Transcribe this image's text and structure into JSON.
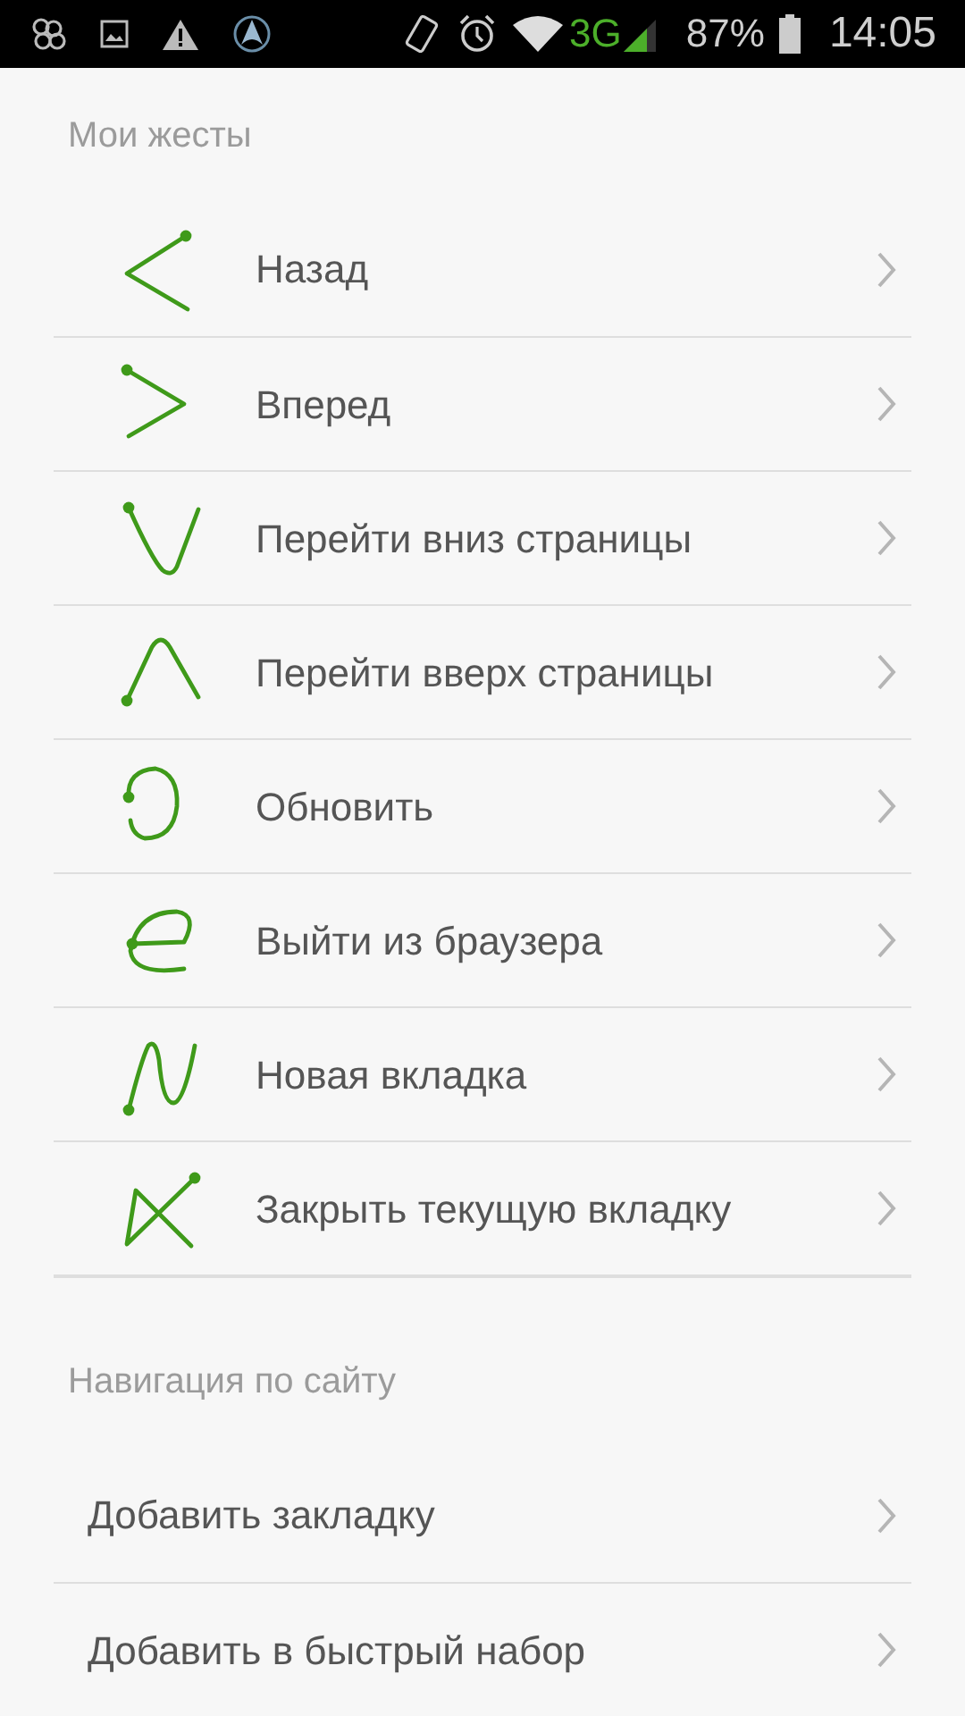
{
  "status_bar": {
    "network": "3G",
    "battery": "87%",
    "time": "14:05"
  },
  "sections": [
    {
      "title": "Мои жесты",
      "items": [
        {
          "label": "Назад",
          "kind": "back"
        },
        {
          "label": "Вперед",
          "kind": "forward"
        },
        {
          "label": "Перейти вниз страницы",
          "kind": "down"
        },
        {
          "label": "Перейти вверх страницы",
          "kind": "up"
        },
        {
          "label": "Обновить",
          "kind": "refresh"
        },
        {
          "label": "Выйти из браузера",
          "kind": "exit"
        },
        {
          "label": "Новая вкладка",
          "kind": "newtab"
        },
        {
          "label": "Закрыть текущую вкладку",
          "kind": "close"
        }
      ]
    },
    {
      "title": "Навигация по сайту",
      "items": [
        {
          "label": "Добавить закладку"
        },
        {
          "label": "Добавить в быстрый набор"
        }
      ]
    }
  ]
}
